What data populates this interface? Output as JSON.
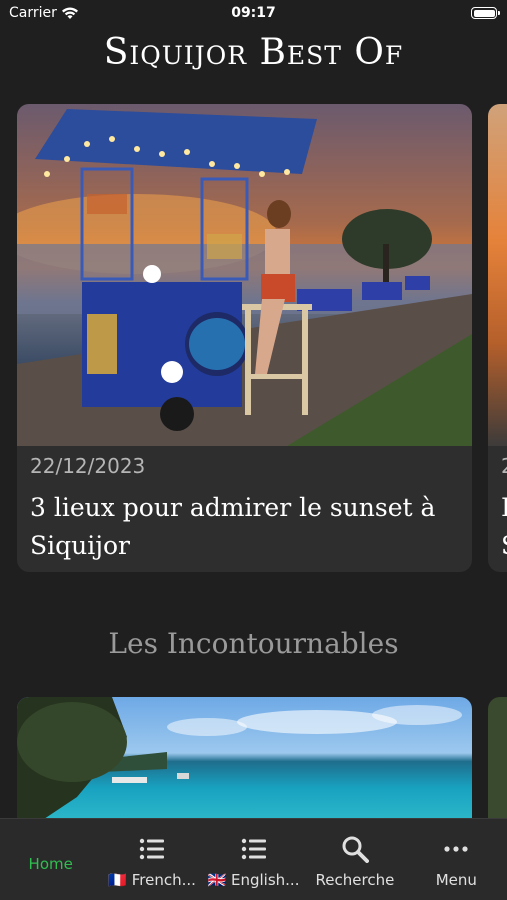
{
  "status_bar": {
    "carrier": "Carrier",
    "time": "09:17"
  },
  "header": {
    "title": "Siquijor Best Of"
  },
  "featured_card": {
    "date": "22/12/2023",
    "title": "3 lieux pour admirer le sunset à Siquijor",
    "image": "sunset beach bar with woman on stool"
  },
  "peek_card": {
    "date": "2",
    "title_fragment": "I",
    "title_fragment_2": "S"
  },
  "section": {
    "heading": "Les Incontournables"
  },
  "second_card": {
    "image": "turquoise sea coastline with boats"
  },
  "tabs": [
    {
      "label": "Home",
      "icon": "none",
      "active": true
    },
    {
      "label": "🇫🇷 French...",
      "icon": "list-icon",
      "active": false
    },
    {
      "label": "🇬🇧 English...",
      "icon": "list-icon",
      "active": false
    },
    {
      "label": "Recherche",
      "icon": "search-icon",
      "active": false
    },
    {
      "label": "Menu",
      "icon": "more-icon",
      "active": false
    }
  ],
  "colors": {
    "active_tab": "#2fbf4f",
    "background": "#1f1f1f",
    "card": "#2e2e2e"
  }
}
